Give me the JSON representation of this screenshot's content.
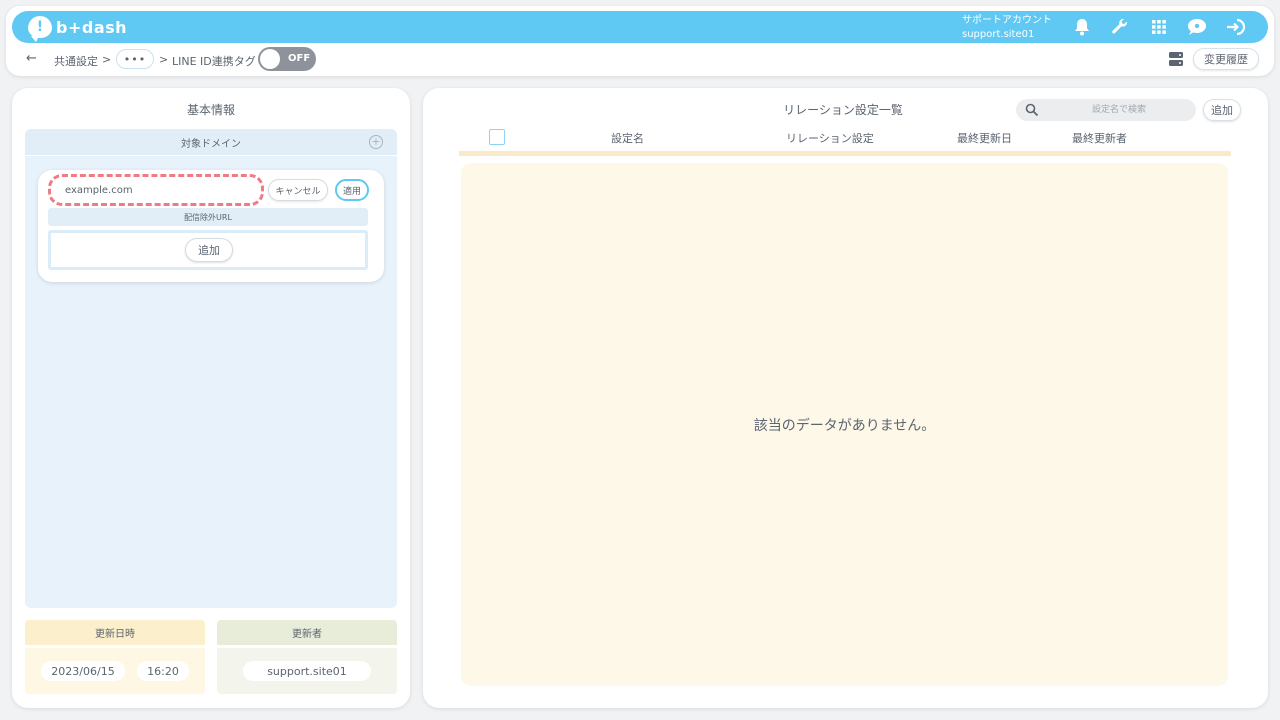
{
  "header": {
    "logo_text": "b+dash",
    "account_label": "サポートアカウント",
    "account_name": "support.site01",
    "icons": [
      "bell-icon",
      "wrench-icon",
      "grid-icon",
      "chat-icon",
      "logout-icon"
    ],
    "brand_color": "#5fc8f3"
  },
  "breadcrumb": {
    "back": "←",
    "item1": "共通設定",
    "sep": ">",
    "more": "•••",
    "item2": "LINE ID連携タグ",
    "toggle_label": "OFF",
    "history_button": "変更履歴"
  },
  "left": {
    "title": "基本情報",
    "target_domain": "対象ドメイン",
    "domain_value": "example.com",
    "cancel": "キャンセル",
    "apply": "適用",
    "exclude_url": "配信除外URL",
    "add": "追加",
    "updated_at_label": "更新日時",
    "updated_by_label": "更新者",
    "updated_date": "2023/06/15",
    "updated_time": "16:20",
    "updated_by": "support.site01"
  },
  "right": {
    "title": "リレーション設定一覧",
    "search_placeholder": "設定名で検索",
    "add": "追加",
    "columns": [
      "設定名",
      "リレーション設定",
      "最終更新日",
      "最終更新者"
    ],
    "empty_message": "該当のデータがありません。"
  }
}
